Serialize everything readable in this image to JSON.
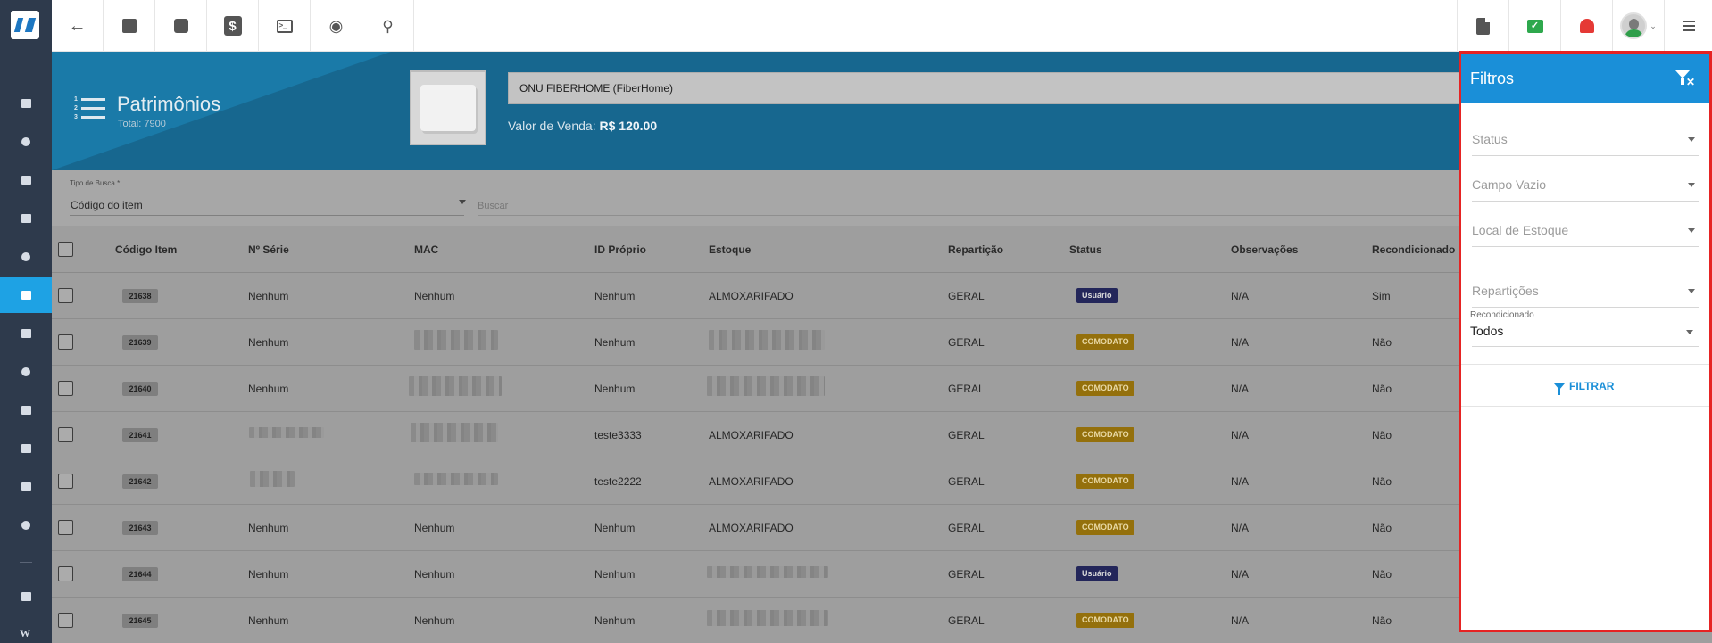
{
  "header": {
    "title": "Patrimônios",
    "total": "Total: 7900"
  },
  "product": {
    "name": "ONU FIBERHOME  (FiberHome)",
    "price_label": "Valor de Venda:",
    "price_value": "R$ 120.00"
  },
  "search": {
    "type_label": "Tipo de Busca *",
    "type_value": "Código do item",
    "placeholder": "Buscar"
  },
  "table": {
    "columns": [
      "Código Item",
      "Nº Série",
      "MAC",
      "ID Próprio",
      "Estoque",
      "Repartição",
      "Status",
      "Observações",
      "Recondicionado"
    ],
    "rows": [
      {
        "code": "21638",
        "serie": "Nenhum",
        "mac": "Nenhum",
        "id": "Nenhum",
        "estoque": "ALMOXARIFADO",
        "reparticao": "GERAL",
        "status": "Usuário",
        "obs": "N/A",
        "recond": "Sim"
      },
      {
        "code": "21639",
        "serie": "Nenhum",
        "mac": "",
        "id": "Nenhum",
        "estoque": "",
        "reparticao": "GERAL",
        "status": "COMODATO",
        "obs": "N/A",
        "recond": "Não"
      },
      {
        "code": "21640",
        "serie": "Nenhum",
        "mac": "",
        "id": "Nenhum",
        "estoque": "",
        "reparticao": "GERAL",
        "status": "COMODATO",
        "obs": "N/A",
        "recond": "Não"
      },
      {
        "code": "21641",
        "serie": "",
        "mac": "",
        "id": "teste3333",
        "estoque": "ALMOXARIFADO",
        "reparticao": "GERAL",
        "status": "COMODATO",
        "obs": "N/A",
        "recond": "Não"
      },
      {
        "code": "21642",
        "serie": "",
        "mac": "",
        "id": "teste2222",
        "estoque": "ALMOXARIFADO",
        "reparticao": "GERAL",
        "status": "COMODATO",
        "obs": "N/A",
        "recond": "Não"
      },
      {
        "code": "21643",
        "serie": "Nenhum",
        "mac": "Nenhum",
        "id": "Nenhum",
        "estoque": "ALMOXARIFADO",
        "reparticao": "GERAL",
        "status": "COMODATO",
        "obs": "N/A",
        "recond": "Não"
      },
      {
        "code": "21644",
        "serie": "Nenhum",
        "mac": "Nenhum",
        "id": "Nenhum",
        "estoque": "",
        "reparticao": "GERAL",
        "status": "Usuário",
        "obs": "N/A",
        "recond": "Não"
      },
      {
        "code": "21645",
        "serie": "Nenhum",
        "mac": "Nenhum",
        "id": "Nenhum",
        "estoque": "",
        "reparticao": "GERAL",
        "status": "COMODATO",
        "obs": "N/A",
        "recond": "Não"
      }
    ]
  },
  "filters": {
    "title": "Filtros",
    "status_placeholder": "Status",
    "campo_vazio_placeholder": "Campo Vazio",
    "local_placeholder": "Local de Estoque",
    "reparticoes_placeholder": "Repartições",
    "recondicionado_label": "Recondicionado",
    "recondicionado_value": "Todos",
    "apply_label": "FILTRAR"
  },
  "icons": {
    "sidebar": [
      "dashboard-icon",
      "pie-chart-icon",
      "contact-icon",
      "kanban-icon",
      "calendar-clock-icon",
      "box-icon",
      "money-icon",
      "map-pin-icon",
      "list-icon",
      "server-icon",
      "document-icon",
      "settings-icon",
      "youtube-icon",
      "wiki-icon"
    ],
    "toolbar": [
      "back-arrow-icon",
      "contact-card-icon",
      "calendar-clock-icon",
      "dollar-icon",
      "terminal-icon",
      "eye-icon",
      "search-icon",
      "pdf-icon",
      "chat-check-icon",
      "bell-icon",
      "user-avatar-icon",
      "menu-list-icon"
    ]
  },
  "colors": {
    "accent": "#1a8fd8",
    "sidebar_bg": "#2e3a4c",
    "panel_border": "#e62323",
    "badge_usuario": "#23265a",
    "badge_comodato": "#94700c"
  }
}
